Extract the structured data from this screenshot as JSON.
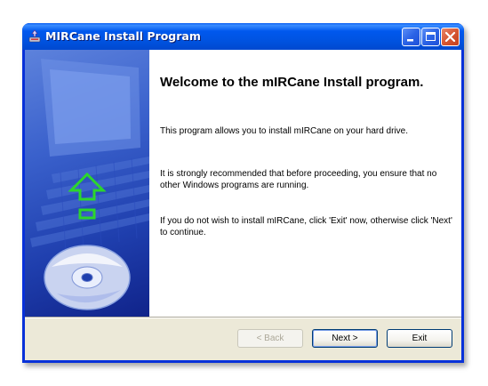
{
  "window": {
    "title": "MIRCane Install Program"
  },
  "content": {
    "heading": "Welcome to the mIRCane Install program.",
    "paragraphs": [
      "This program allows you to install mIRCane on your hard drive.",
      "It is strongly recommended that before proceeding, you ensure that no other Windows programs are running.",
      "If you do not wish to install mIRCane, click 'Exit' now, otherwise click 'Next' to continue."
    ]
  },
  "buttons": {
    "back": "< Back",
    "next": "Next >",
    "exit": "Exit"
  },
  "colors": {
    "titlebar": "#0054e3",
    "banner": "#2a4cbe",
    "arrow": "#2cd62c",
    "close_button": "#d65632"
  },
  "icons": {
    "app": "installer-icon",
    "minimize": "minimize-icon",
    "maximize": "maximize-icon",
    "close": "close-icon"
  }
}
